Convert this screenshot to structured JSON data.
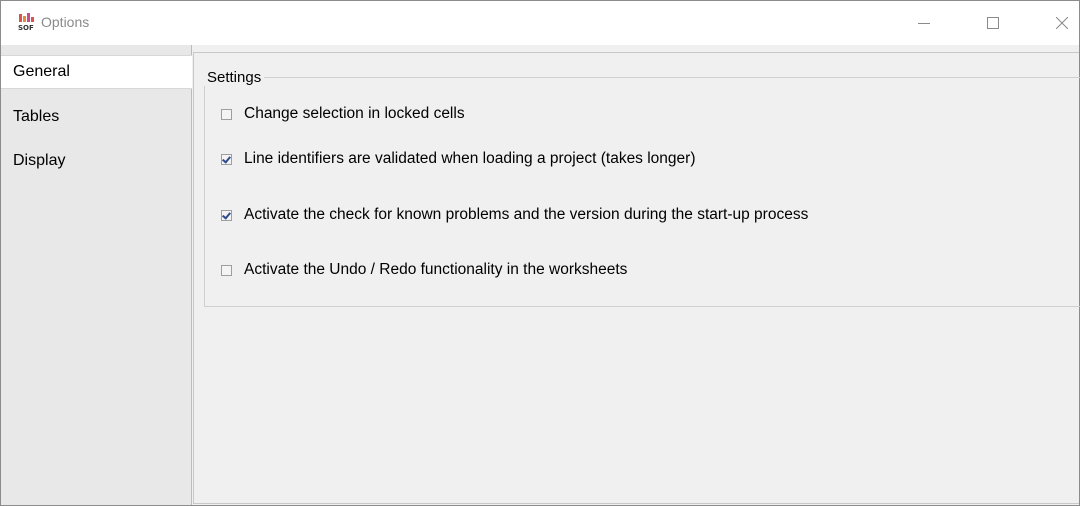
{
  "window": {
    "title": "Options",
    "icon": "sof-app-icon"
  },
  "titlebar": {
    "minimize_icon": "minimize-icon",
    "maximize_icon": "maximize-icon",
    "close_icon": "close-icon"
  },
  "sidebar": {
    "items": [
      {
        "label": "General",
        "selected": true
      },
      {
        "label": "Tables",
        "selected": false
      },
      {
        "label": "Display",
        "selected": false
      }
    ]
  },
  "settings": {
    "legend": "Settings",
    "options": [
      {
        "label": "Change selection in locked cells",
        "checked": false
      },
      {
        "label": "Line identifiers are validated when loading a project (takes longer)",
        "checked": true
      },
      {
        "label": "Activate the check for known problems and the version during the start-up process",
        "checked": true
      },
      {
        "label": "Activate the Undo / Redo functionality in the worksheets",
        "checked": false
      }
    ]
  },
  "colors": {
    "check_color": "#2d4a8c",
    "panel_bg": "#f0f0f0",
    "sidebar_bg": "#e8e8e8"
  }
}
